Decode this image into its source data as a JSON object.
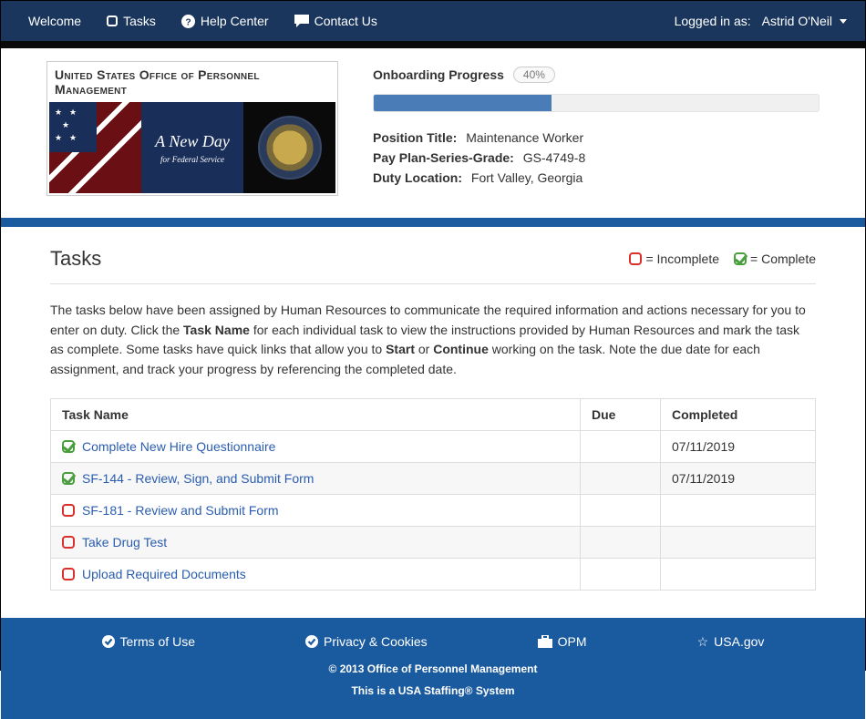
{
  "nav": {
    "welcome": "Welcome",
    "tasks": "Tasks",
    "help": "Help Center",
    "contact": "Contact Us",
    "logged_in_label": "Logged in as:",
    "user_name": "Astrid O'Neil"
  },
  "logo": {
    "title": "United States Office of Personnel Management",
    "script": "A New Day",
    "sub": "for Federal Service"
  },
  "progress": {
    "label": "Onboarding Progress",
    "percent_text": "40%",
    "percent": 40
  },
  "position": {
    "title_label": "Position Title:",
    "title_value": "Maintenance Worker",
    "plan_label": "Pay Plan-Series-Grade:",
    "plan_value": "GS-4749-8",
    "duty_label": "Duty Location:",
    "duty_value": "Fort Valley, Georgia"
  },
  "section": {
    "title": "Tasks",
    "legend_incomplete": "= Incomplete",
    "legend_complete": "= Complete"
  },
  "intro": {
    "t1": "The tasks below have been assigned by Human Resources to communicate the required information and actions necessary for you to enter on duty. Click the ",
    "b1": "Task Name",
    "t2": " for each individual task to view the instructions provided by Human Resources and mark the task as complete. Some tasks have quick links that allow you to ",
    "b2": "Start",
    "t3": " or ",
    "b3": "Continue",
    "t4": " working on the task. Note the due date for each assignment, and track your progress by referencing the completed date."
  },
  "table": {
    "h_task": "Task Name",
    "h_due": "Due",
    "h_comp": "Completed",
    "rows": [
      {
        "complete": true,
        "name": "Complete New Hire Questionnaire",
        "due": "",
        "completed": "07/11/2019"
      },
      {
        "complete": true,
        "name": "SF-144 - Review, Sign, and Submit Form",
        "due": "",
        "completed": "07/11/2019"
      },
      {
        "complete": false,
        "name": "SF-181 - Review and Submit Form",
        "due": "",
        "completed": ""
      },
      {
        "complete": false,
        "name": "Take Drug Test",
        "due": "",
        "completed": ""
      },
      {
        "complete": false,
        "name": "Upload Required Documents",
        "due": "",
        "completed": ""
      }
    ]
  },
  "footer": {
    "terms": "Terms of Use",
    "privacy": "Privacy & Cookies",
    "opm": "OPM",
    "usa": "USA.gov",
    "copyright": "© 2013 Office of Personnel Management",
    "system": "This is a USA Staffing® System"
  }
}
